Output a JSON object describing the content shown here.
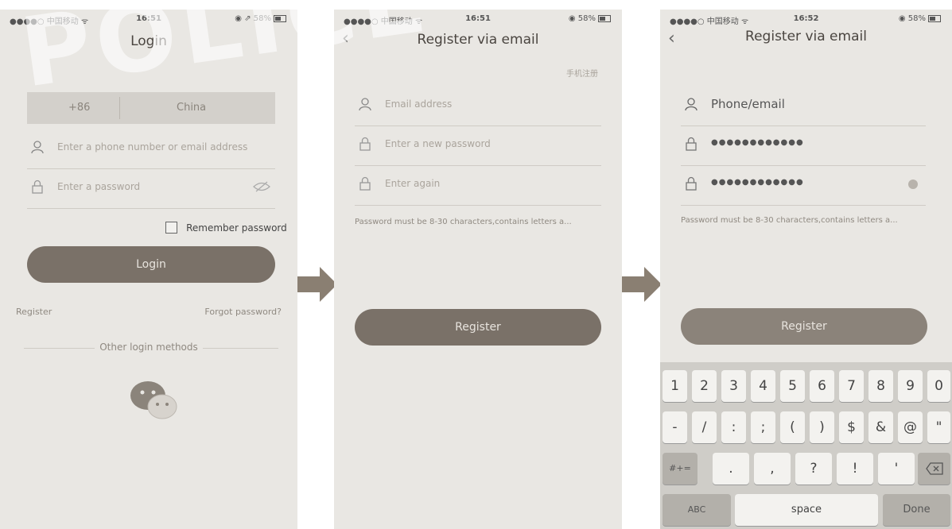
{
  "watermark": "POLICE",
  "screen1": {
    "status": {
      "carrier": "●●●●○ 中国移动 ᯤ",
      "time": "16:51",
      "battery": "◉ ⇗ 58%"
    },
    "title": "Login",
    "country_code": "+86",
    "country": "China",
    "phone_placeholder": "Enter a phone number or email address",
    "password_placeholder": "Enter a password",
    "remember_label": "Remember password",
    "login_button": "Login",
    "register_link": "Register",
    "forgot_link": "Forgot password?",
    "other_methods": "Other login methods"
  },
  "screen2": {
    "status": {
      "carrier": "●●●●○ 中国移动 ᯤ",
      "time": "16:51",
      "battery": "◉ 58%"
    },
    "title": "Register via email",
    "top_right_link": "手机注册",
    "email_placeholder": "Email address",
    "new_password_placeholder": "Enter a new password",
    "again_placeholder": "Enter again",
    "hint": "Password must be 8-30 characters,contains letters a...",
    "register_button": "Register"
  },
  "screen3": {
    "status": {
      "carrier": "●●●●○ 中国移动 ᯤ",
      "time": "16:52",
      "battery": "◉ 58%"
    },
    "title": "Register via email",
    "email_value": "Phone/email",
    "password_dots": "●●●●●●●●●●●●",
    "again_dots": "●●●●●●●●●●●●",
    "hint": "Password must be 8-30 characters,contains letters a...",
    "register_button": "Register",
    "keyboard": {
      "row1": [
        "1",
        "2",
        "3",
        "4",
        "5",
        "6",
        "7",
        "8",
        "9",
        "0"
      ],
      "row2": [
        "-",
        "/",
        ":",
        ";",
        "(",
        ")",
        "$",
        "&",
        "@",
        "\""
      ],
      "row3_mode": "#+=",
      "row3": [
        ".",
        ",",
        "?",
        "!",
        "'"
      ],
      "row4_abc": "ABC",
      "space": "space",
      "done": "Done"
    }
  }
}
